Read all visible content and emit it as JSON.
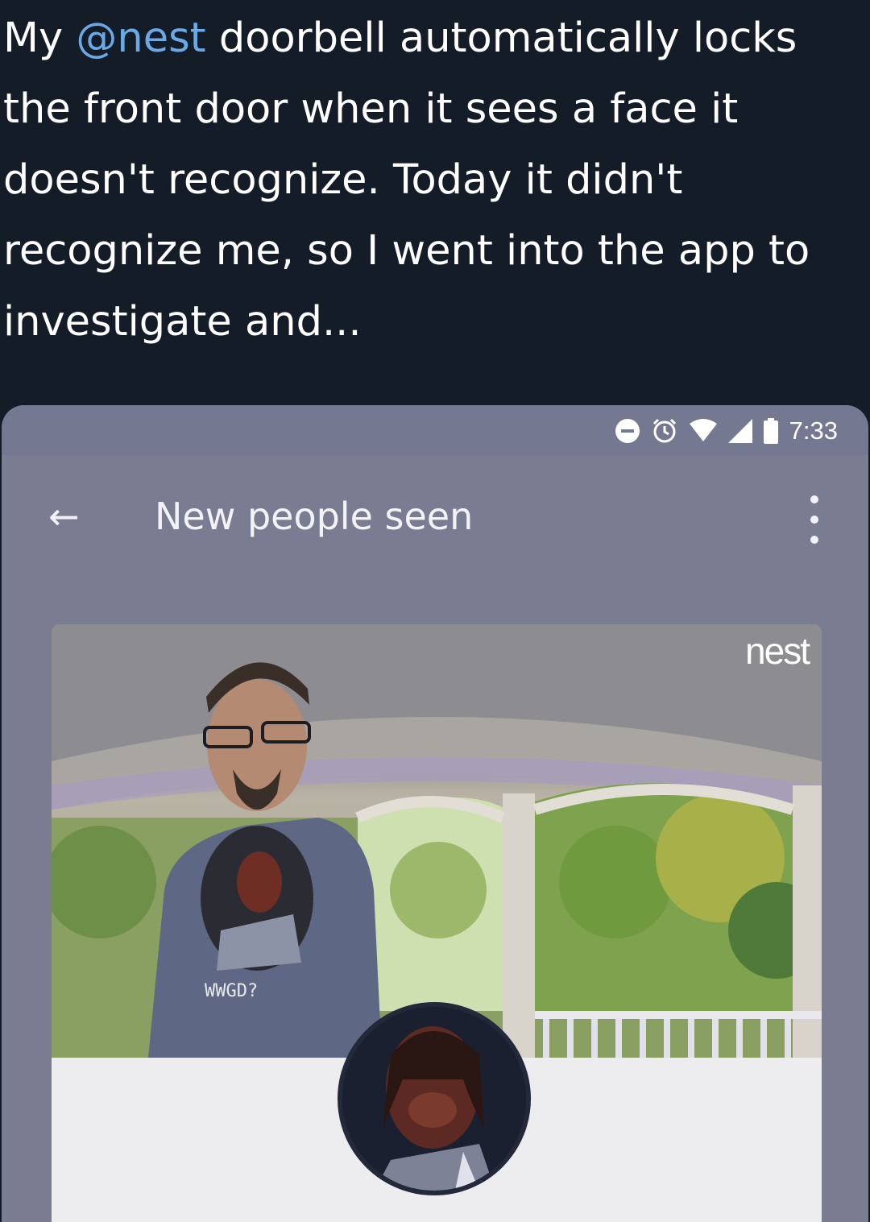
{
  "post": {
    "text_before_mention": "My ",
    "mention": "@nest",
    "text_after_mention": " doorbell automatically locks the front door when it sees a face it doesn't recognize. Today it didn't recognize me, so I went into the app to investigate and..."
  },
  "statusbar": {
    "time": "7:33"
  },
  "appbar": {
    "back_glyph": "←",
    "title": "New people seen"
  },
  "camera": {
    "watermark": "nest",
    "shirt_text": "WWGD?"
  }
}
